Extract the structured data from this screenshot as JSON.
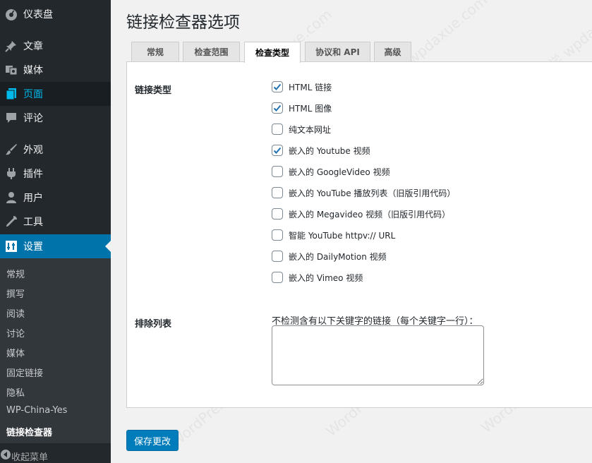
{
  "sidebar": {
    "items": [
      {
        "label": "仪表盘",
        "icon": "dashboard-icon"
      },
      {
        "label": "文章",
        "icon": "pin-icon"
      },
      {
        "label": "媒体",
        "icon": "media-icon"
      },
      {
        "label": "页面",
        "icon": "page-icon"
      },
      {
        "label": "评论",
        "icon": "comment-icon"
      },
      {
        "label": "外观",
        "icon": "brush-icon"
      },
      {
        "label": "插件",
        "icon": "plugin-icon"
      },
      {
        "label": "用户",
        "icon": "user-icon"
      },
      {
        "label": "工具",
        "icon": "wrench-icon"
      },
      {
        "label": "设置",
        "icon": "settings-icon"
      }
    ],
    "submenu": [
      "常规",
      "撰写",
      "阅读",
      "讨论",
      "媒体",
      "固定链接",
      "隐私",
      "WP-China-Yes",
      "链接检查器"
    ],
    "collapse_label": "收起菜单"
  },
  "page": {
    "title": "链接检查器选项",
    "tabs": [
      "常规",
      "检查范围",
      "检查类型",
      "协议和 API",
      "高级"
    ],
    "active_tab": "检查类型"
  },
  "link_types": {
    "label": "链接类型",
    "options": [
      {
        "label": "HTML 链接",
        "checked": true
      },
      {
        "label": "HTML 图像",
        "checked": true
      },
      {
        "label": "纯文本网址",
        "checked": false
      },
      {
        "label": "嵌入的 Youtube 视频",
        "checked": true
      },
      {
        "label": "嵌入的 GoogleVideo 视频",
        "checked": false
      },
      {
        "label": "嵌入的 YouTube 播放列表（旧版引用代码）",
        "checked": false
      },
      {
        "label": "嵌入的 Megavideo 视频（旧版引用代码）",
        "checked": false
      },
      {
        "label": "智能 YouTube httpv:// URL",
        "checked": false
      },
      {
        "label": "嵌入的 DailyMotion 视频",
        "checked": false
      },
      {
        "label": "嵌入的 Vimeo 视频",
        "checked": false
      }
    ]
  },
  "exclude": {
    "label": "排除列表",
    "description": "不检测含有以下关键字的链接（每个关键字一行）：",
    "value": ""
  },
  "save_label": "保存更改",
  "watermark": "WordPress大学 wpdaxue.com",
  "colors": {
    "sidebar_bg": "#23282d",
    "accent": "#0073aa",
    "button": "#007cba",
    "current_link": "#00b9eb"
  }
}
